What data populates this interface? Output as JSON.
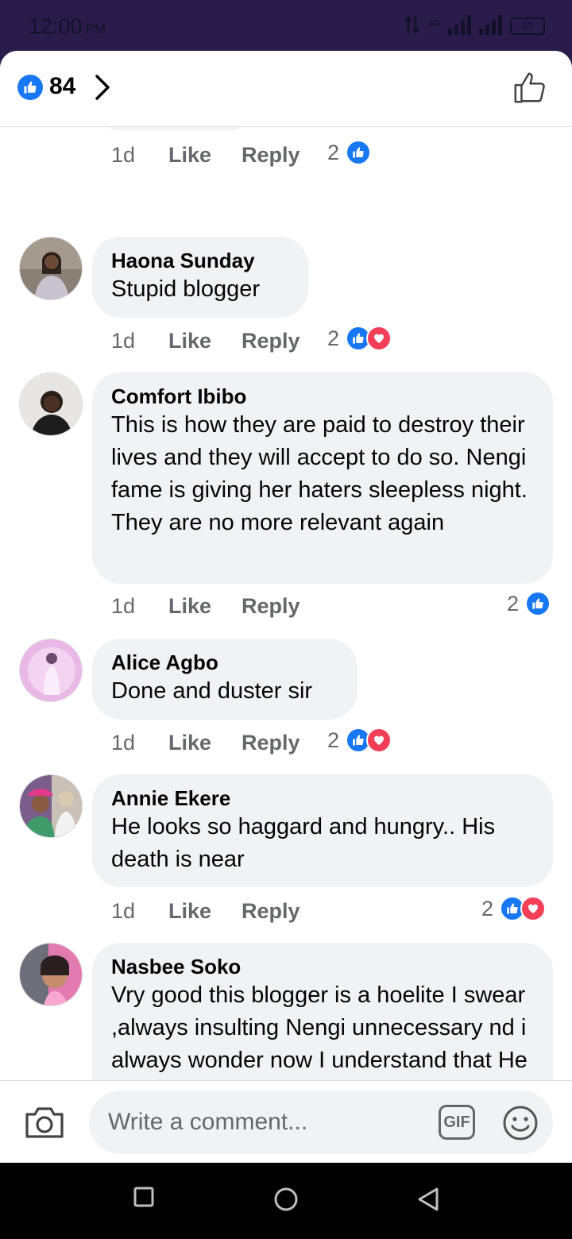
{
  "status_bar": {
    "time": "12:00",
    "ampm": "PM",
    "network": "4G",
    "battery": "63"
  },
  "header": {
    "reaction_count": "84"
  },
  "first_comment_meta": {
    "time": "1d",
    "like": "Like",
    "reply": "Reply",
    "reaction_count": "2"
  },
  "comments": [
    {
      "author": "Haona Sunday",
      "text": "Stupid blogger",
      "time": "1d",
      "like": "Like",
      "reply": "Reply",
      "reaction_count": "2"
    },
    {
      "author": "Comfort Ibibo",
      "text": "This is how they are paid to destroy their lives and they will accept to do so. Nengi fame is giving her haters sleepless night. They are no more relevant again",
      "time": "1d",
      "like": "Like",
      "reply": "Reply",
      "reaction_count": "2"
    },
    {
      "author": "Alice Agbo",
      "text": "Done and duster sir",
      "time": "1d",
      "like": "Like",
      "reply": "Reply",
      "reaction_count": "2"
    },
    {
      "author": "Annie Ekere",
      "text": "He looks so haggard and hungry.. His death is near",
      "time": "1d",
      "like": "Like",
      "reply": "Reply",
      "reaction_count": "2"
    },
    {
      "author": "Nasbee Soko",
      "text": "Vry good this blogger is a hoelite I swear ,always insulting Nengi unnecessary nd i always wonder now I understand that He has long nose for pokonosing Hon Nene is life idiot"
    }
  ],
  "composer": {
    "placeholder": "Write a comment...",
    "gif_label": "GIF"
  },
  "colors": {
    "facebook_blue": "#1877f2",
    "love_red": "#f33e58",
    "bubble_gray": "#f0f2f5",
    "status_bar_purple": "#2a1c4a"
  }
}
